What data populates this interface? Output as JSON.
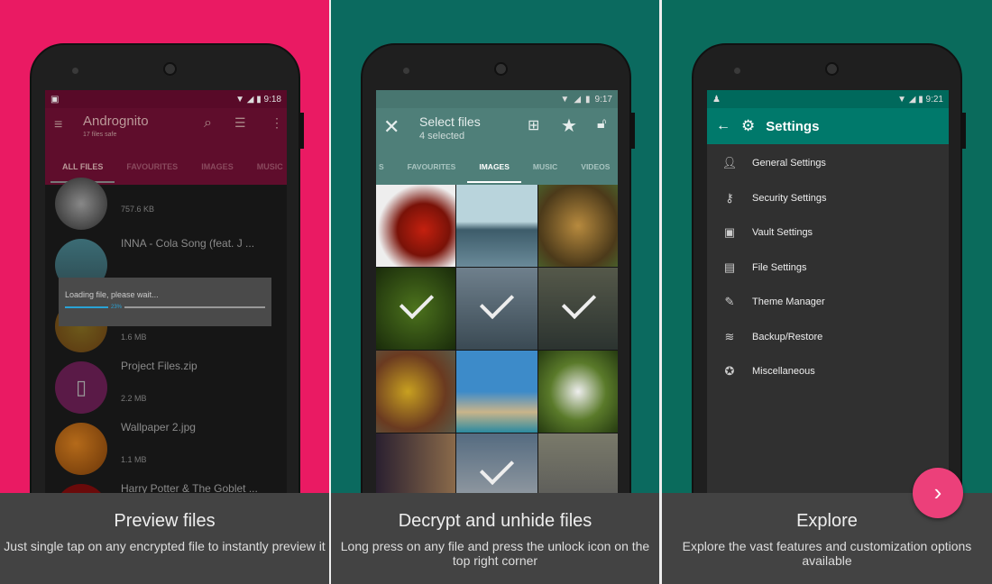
{
  "panels": [
    {
      "caption": "Preview files",
      "description": "Just single tap on any encrypted file to instantly preview it",
      "status_time": "9:18",
      "app_title": "Andrognito",
      "app_subtitle": "17 files safe",
      "tabs": [
        "ALL FILES",
        "FAVOURITES",
        "IMAGES",
        "MUSIC"
      ],
      "files": [
        {
          "name": "",
          "size": "757.6 KB"
        },
        {
          "name": "INNA - Cola Song (feat. J ...",
          "size": ""
        },
        {
          "name": "",
          "size": "1.6 MB"
        },
        {
          "name": "Project Files.zip",
          "size": "2.2 MB"
        },
        {
          "name": "Wallpaper 2.jpg",
          "size": "1.1 MB"
        },
        {
          "name": "Harry Potter & The Goblet ...",
          "size": ""
        }
      ],
      "dialog": {
        "text": "Loading file, please wait...",
        "progress_label": "23%",
        "progress": 0.23
      },
      "accent": "#ea1a63",
      "toolbar_color": "#5a0b2a"
    },
    {
      "caption": "Decrypt and unhide files",
      "description": "Long press on any file and press the unlock icon on the top right corner",
      "status_time": "9:17",
      "title": "Select files",
      "subtitle": "4 selected",
      "tabs": [
        "S",
        "FAVOURITES",
        "IMAGES",
        "MUSIC",
        "VIDEOS"
      ],
      "selected_images": [
        4,
        5,
        6,
        11
      ],
      "toolbar_color": "#4e7e78"
    },
    {
      "caption": "Explore",
      "description": "Explore the vast features and customization options available",
      "status_time": "9:21",
      "title": "Settings",
      "settings": [
        {
          "label": "General Settings",
          "icon": "person-icon"
        },
        {
          "label": "Security Settings",
          "icon": "key-icon"
        },
        {
          "label": "Vault Settings",
          "icon": "vault-icon"
        },
        {
          "label": "File Settings",
          "icon": "file-icon"
        },
        {
          "label": "Theme Manager",
          "icon": "brush-icon"
        },
        {
          "label": "Backup/Restore",
          "icon": "database-icon"
        },
        {
          "label": "Miscellaneous",
          "icon": "misc-icon"
        }
      ],
      "header_color": "#00796b"
    }
  ]
}
